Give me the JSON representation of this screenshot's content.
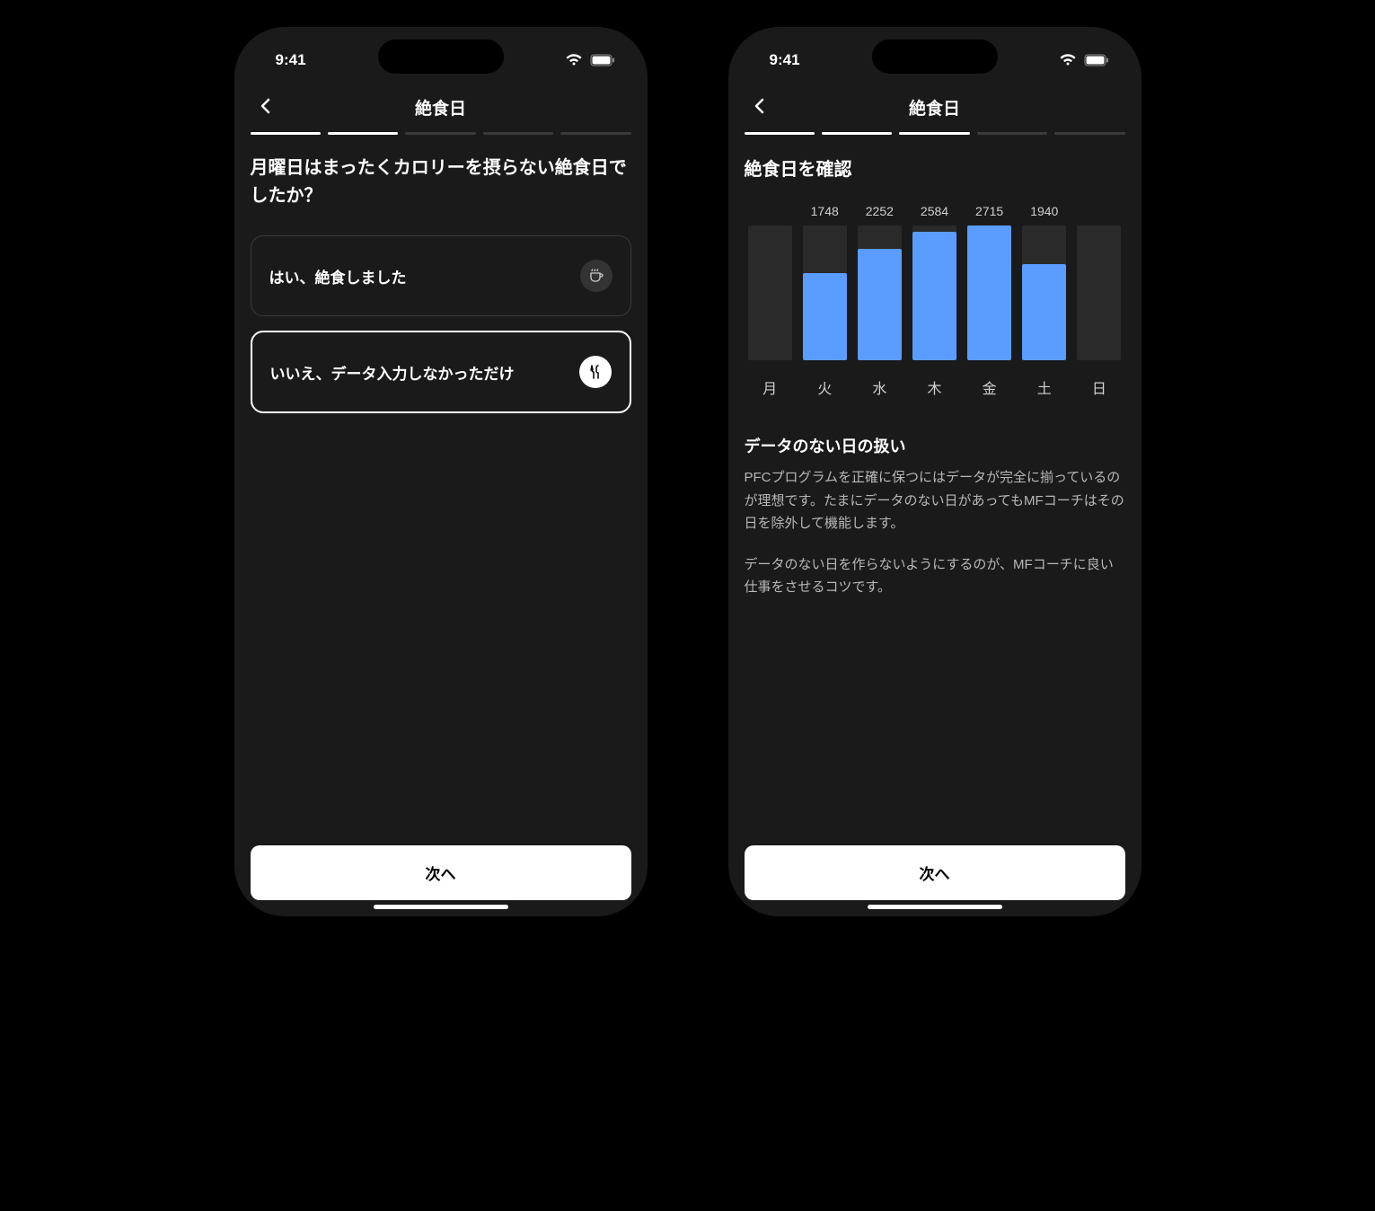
{
  "status": {
    "time": "9:41"
  },
  "header": {
    "title": "絶食日"
  },
  "progress": {
    "left": {
      "total": 5,
      "active": 2
    },
    "right": {
      "total": 5,
      "active": 3
    }
  },
  "screen_left": {
    "question": "月曜日はまったくカロリーを摂らない絶食日でしたか？",
    "options": {
      "yes": "はい、絶食しました",
      "no": "いいえ、データ入力しなかっただけ"
    }
  },
  "screen_right": {
    "section_title": "絶食日を確認",
    "info_title": "データのない日の扱い",
    "info_p1": "PFCプログラムを正確に保つにはデータが完全に揃っているのが理想です。たまにデータのない日があってもMFコーチはその日を除外して機能します。",
    "info_p2": "データのない日を作らないようにするのが、MFコーチに良い仕事をさせるコツです。"
  },
  "chart_data": {
    "type": "bar",
    "categories": [
      "月",
      "火",
      "水",
      "木",
      "金",
      "土",
      "日"
    ],
    "values": [
      null,
      1748,
      2252,
      2584,
      2715,
      1940,
      null
    ],
    "ylim": [
      0,
      2715
    ],
    "title": "絶食日を確認"
  },
  "footer": {
    "next": "次へ"
  }
}
